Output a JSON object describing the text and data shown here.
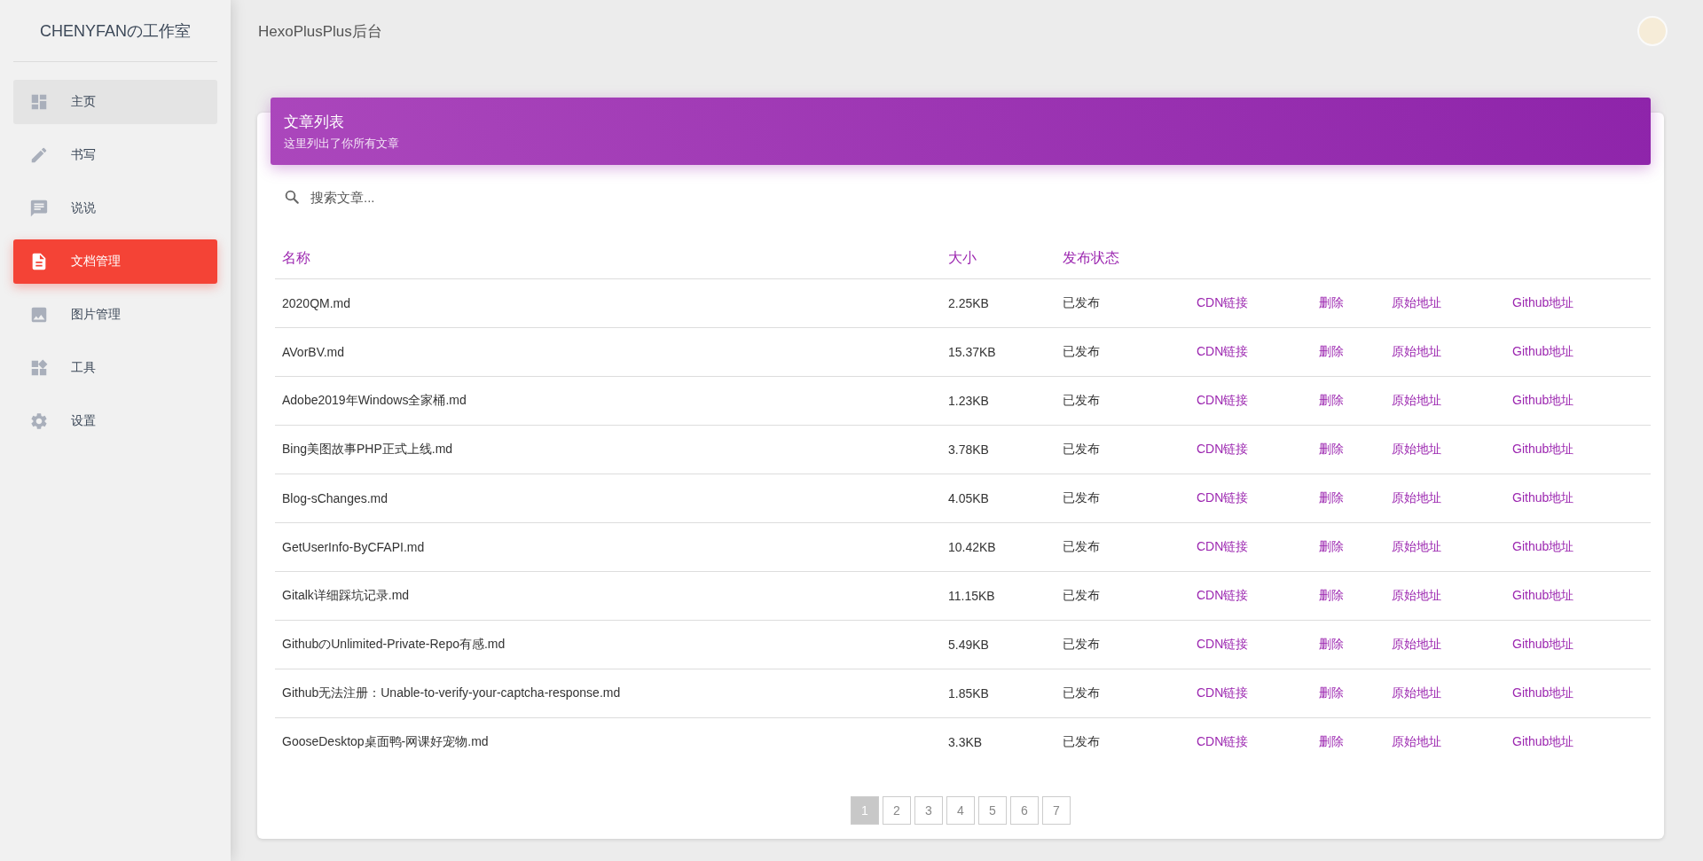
{
  "sidebar": {
    "title": "CHENYFANの工作室",
    "items": [
      {
        "kind": "dashboard",
        "label": "主页",
        "selected": false,
        "hovered": true
      },
      {
        "kind": "pencil",
        "label": "书写",
        "selected": false,
        "hovered": false
      },
      {
        "kind": "chat",
        "label": "说说",
        "selected": false,
        "hovered": false
      },
      {
        "kind": "document",
        "label": "文档管理",
        "selected": true,
        "hovered": false
      },
      {
        "kind": "image",
        "label": "图片管理",
        "selected": false,
        "hovered": false
      },
      {
        "kind": "widgets",
        "label": "工具",
        "selected": false,
        "hovered": false
      },
      {
        "kind": "gear",
        "label": "设置",
        "selected": false,
        "hovered": false
      }
    ]
  },
  "topbar": {
    "title": "HexoPlusPlus后台"
  },
  "card": {
    "title": "文章列表",
    "subtitle": "这里列出了你所有文章",
    "search": {
      "placeholder": "搜索文章..."
    },
    "table": {
      "columns": [
        "名称",
        "大小",
        "发布状态"
      ],
      "rows": [
        {
          "name": "2020QM.md",
          "size": "2.25KB",
          "status": "已发布",
          "actions": [
            "CDN链接",
            "删除",
            "原始地址",
            "Github地址"
          ]
        },
        {
          "name": "AVorBV.md",
          "size": "15.37KB",
          "status": "已发布",
          "actions": [
            "CDN链接",
            "删除",
            "原始地址",
            "Github地址"
          ]
        },
        {
          "name": "Adobe2019年Windows全家桶.md",
          "size": "1.23KB",
          "status": "已发布",
          "actions": [
            "CDN链接",
            "删除",
            "原始地址",
            "Github地址"
          ]
        },
        {
          "name": "Bing美图故事PHP正式上线.md",
          "size": "3.78KB",
          "status": "已发布",
          "actions": [
            "CDN链接",
            "删除",
            "原始地址",
            "Github地址"
          ]
        },
        {
          "name": "Blog-sChanges.md",
          "size": "4.05KB",
          "status": "已发布",
          "actions": [
            "CDN链接",
            "删除",
            "原始地址",
            "Github地址"
          ]
        },
        {
          "name": "GetUserInfo-ByCFAPI.md",
          "size": "10.42KB",
          "status": "已发布",
          "actions": [
            "CDN链接",
            "删除",
            "原始地址",
            "Github地址"
          ]
        },
        {
          "name": "Gitalk详细踩坑记录.md",
          "size": "11.15KB",
          "status": "已发布",
          "actions": [
            "CDN链接",
            "删除",
            "原始地址",
            "Github地址"
          ]
        },
        {
          "name": "GithubのUnlimited-Private-Repo有感.md",
          "size": "5.49KB",
          "status": "已发布",
          "actions": [
            "CDN链接",
            "删除",
            "原始地址",
            "Github地址"
          ]
        },
        {
          "name": "Github无法注册：Unable-to-verify-your-captcha-response.md",
          "size": "1.85KB",
          "status": "已发布",
          "actions": [
            "CDN链接",
            "删除",
            "原始地址",
            "Github地址"
          ]
        },
        {
          "name": "GooseDesktop桌面鸭-网课好宠物.md",
          "size": "3.3KB",
          "status": "已发布",
          "actions": [
            "CDN链接",
            "删除",
            "原始地址",
            "Github地址"
          ]
        }
      ]
    },
    "pagination": [
      {
        "label": "1",
        "selected": true
      },
      {
        "label": "2",
        "selected": false
      },
      {
        "label": "3",
        "selected": false
      },
      {
        "label": "4",
        "selected": false
      },
      {
        "label": "5",
        "selected": false
      },
      {
        "label": "6",
        "selected": false
      },
      {
        "label": "7",
        "selected": false
      }
    ]
  }
}
